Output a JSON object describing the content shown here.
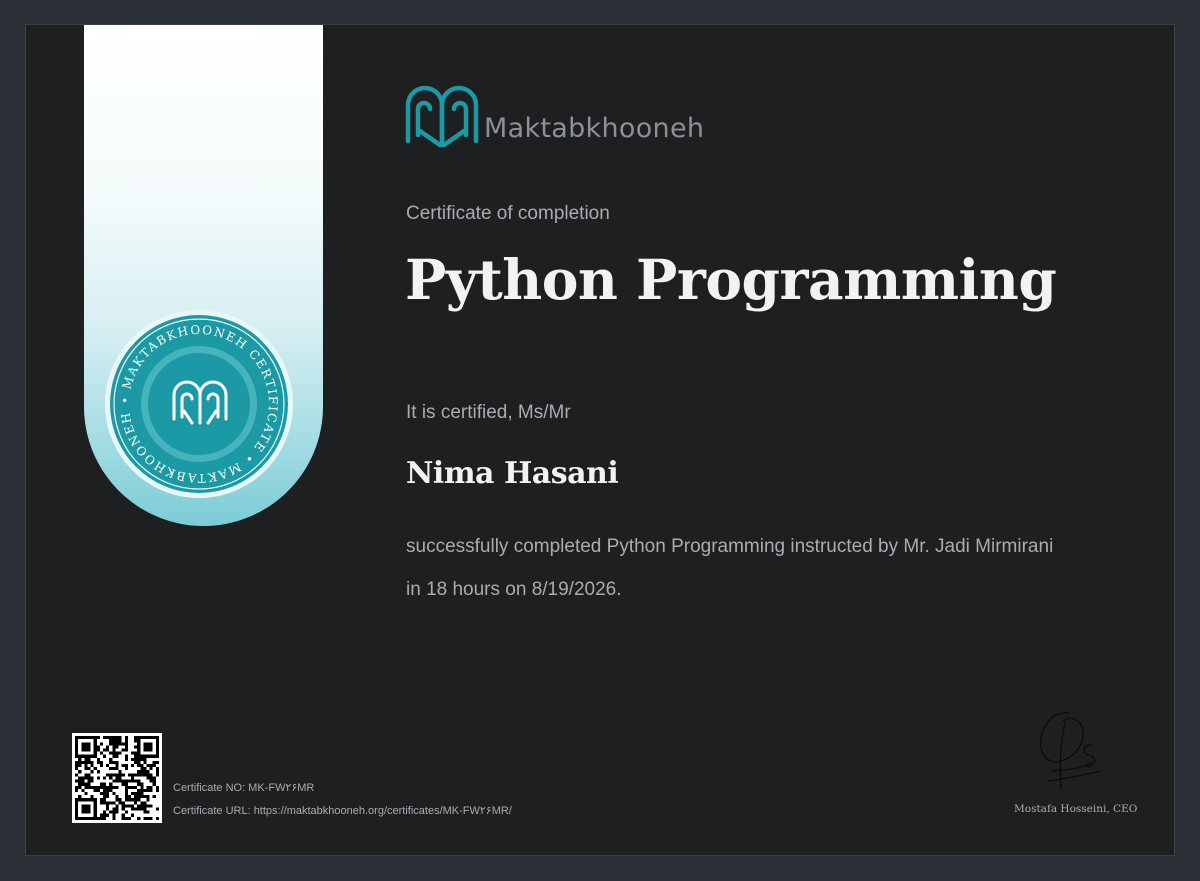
{
  "brand": {
    "name": "Maktabkhooneh",
    "seal_text": "MAKTABKHOONEH CERTIFICATE",
    "accent_color": "#1b9aa6",
    "logo_icon": "open-book-arch-logo-icon"
  },
  "certificate": {
    "subtitle": "Certificate of completion",
    "course_title": "Python Programming",
    "certified_label": "It is certified, Ms/Mr",
    "recipient_name": "Nima Hasani",
    "description": "successfully completed Python Programming instructed by Mr. Jadi Mirmirani in 18 hours on 8/19/2026."
  },
  "footer": {
    "certificate_no": "Certificate NO: MK-FW۲۶MR",
    "certificate_url": "Certificate URL: https://maktabkhooneh.org/certificates/MK-FW۲۶MR/",
    "signer": "Mostafa Hosseini, CEO",
    "qr_icon": "qr-code-icon",
    "signature_icon": "handwritten-signature-icon"
  }
}
